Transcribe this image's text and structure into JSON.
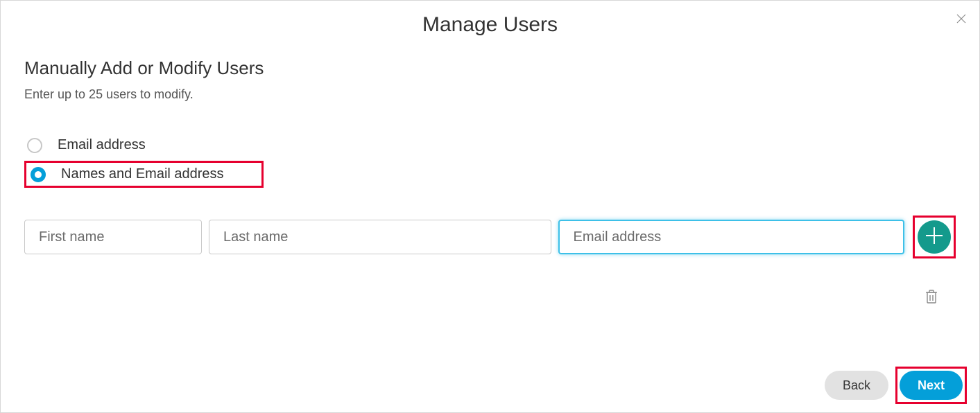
{
  "dialog": {
    "title": "Manage Users"
  },
  "section": {
    "title": "Manually Add or Modify Users",
    "subtitle": "Enter up to 25 users to modify."
  },
  "radios": {
    "email_only": "Email address",
    "names_and_email": "Names and Email address"
  },
  "fields": {
    "first_name_placeholder": "First name",
    "last_name_placeholder": "Last name",
    "email_placeholder": "Email address"
  },
  "footer": {
    "back": "Back",
    "next": "Next"
  }
}
